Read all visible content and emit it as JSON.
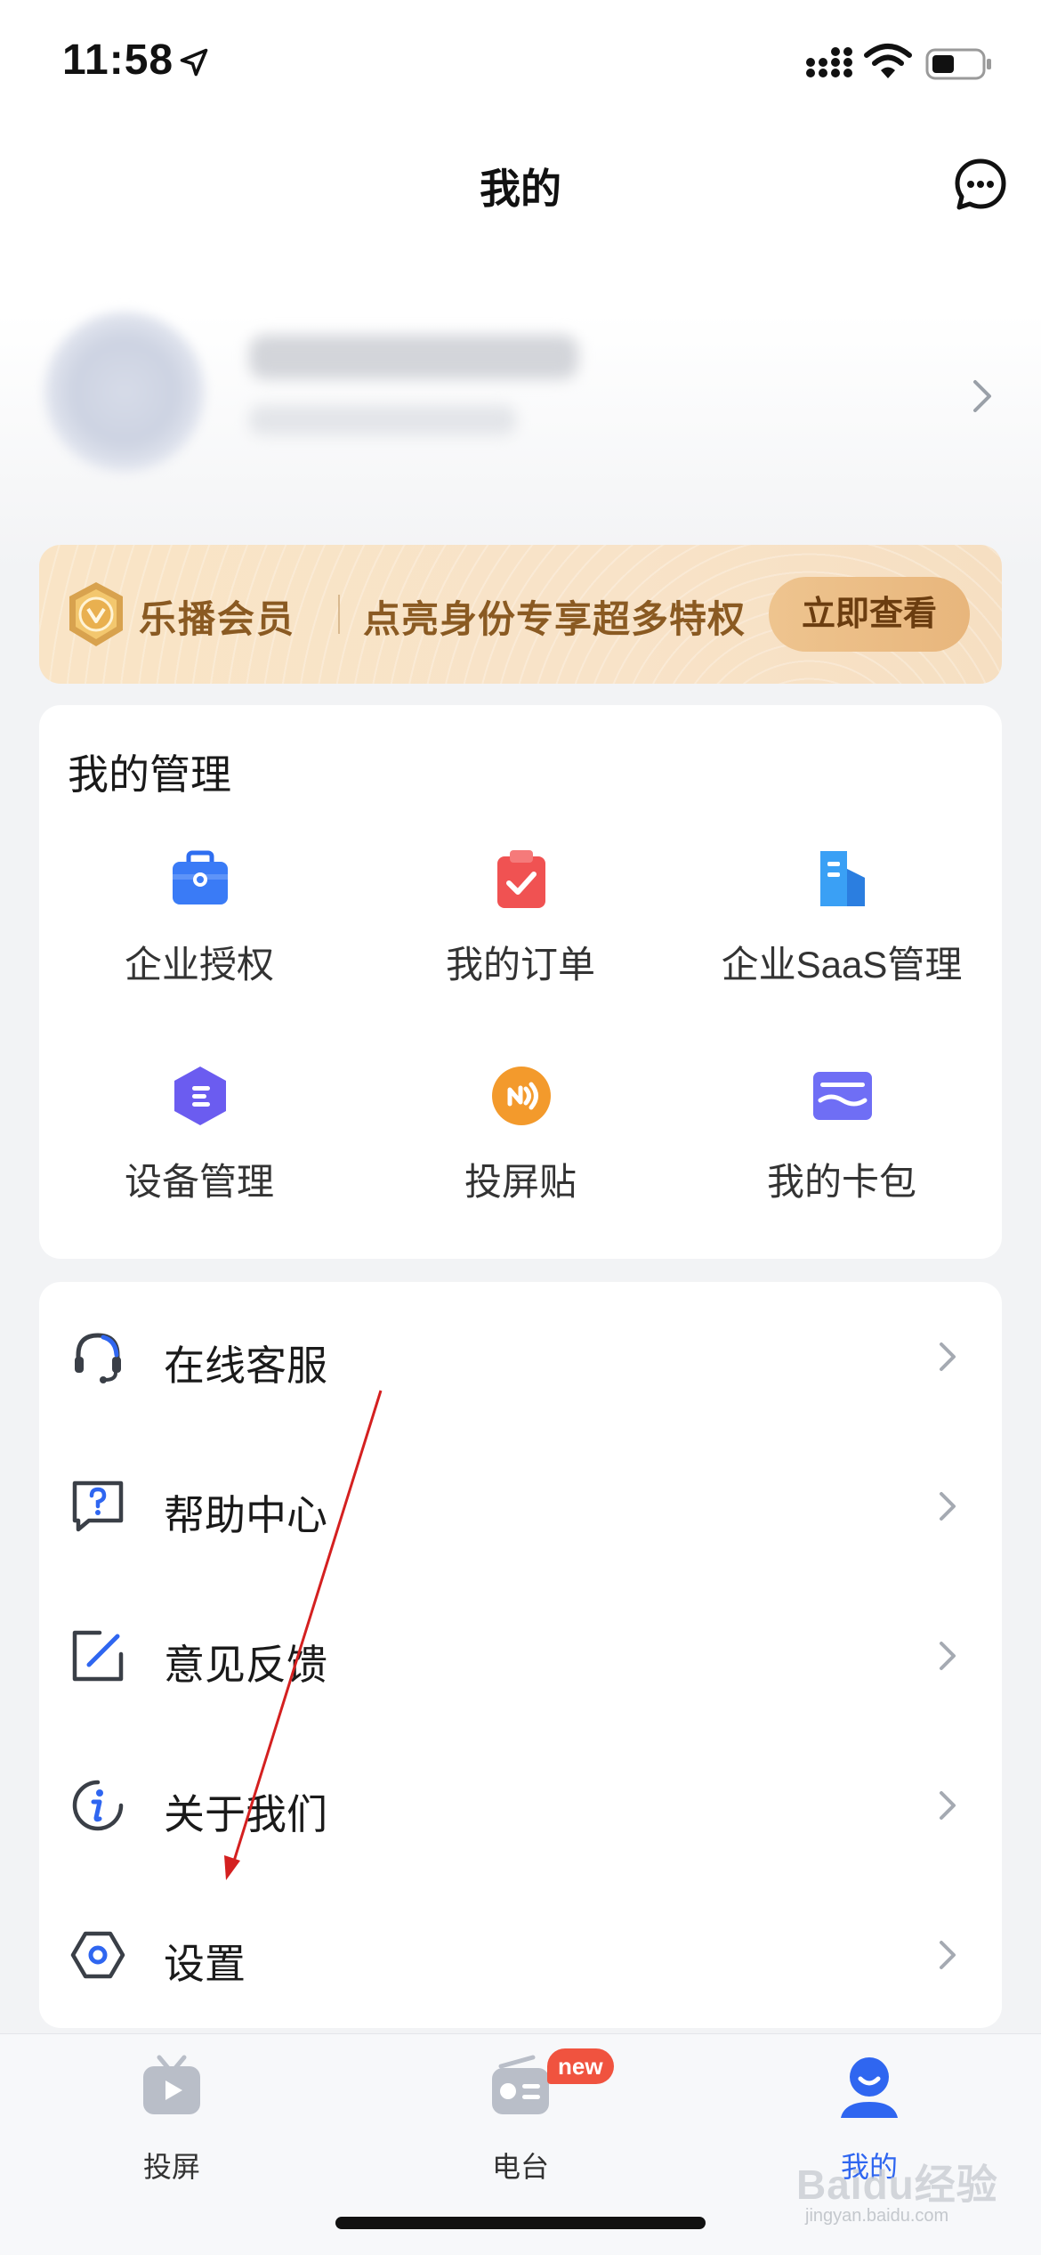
{
  "status_bar": {
    "time": "11:58"
  },
  "header": {
    "title": "我的"
  },
  "vip": {
    "title": "乐播会员",
    "description": "点亮身份专享超多特权",
    "button": "立即查看"
  },
  "management": {
    "title": "我的管理",
    "items": [
      {
        "label": "企业授权",
        "icon": "briefcase-icon",
        "color": "#3a7bf6"
      },
      {
        "label": "我的订单",
        "icon": "clipboard-check-icon",
        "color": "#f05252"
      },
      {
        "label": "企业SaaS管理",
        "icon": "building-icon",
        "color": "#3aa0f5"
      },
      {
        "label": "设备管理",
        "icon": "hexagon-list-icon",
        "color": "#6b5cf0"
      },
      {
        "label": "投屏贴",
        "icon": "nfc-sticker-icon",
        "color": "#f39a2c"
      },
      {
        "label": "我的卡包",
        "icon": "card-wallet-icon",
        "color": "#6f6ef5"
      }
    ]
  },
  "menu": [
    {
      "label": "在线客服",
      "icon": "headset-icon"
    },
    {
      "label": "帮助中心",
      "icon": "help-question-icon"
    },
    {
      "label": "意见反馈",
      "icon": "edit-feedback-icon"
    },
    {
      "label": "关于我们",
      "icon": "info-icon"
    },
    {
      "label": "设置",
      "icon": "settings-hexagon-icon"
    }
  ],
  "tabbar": [
    {
      "label": "投屏",
      "icon": "tv-play-icon",
      "active": false
    },
    {
      "label": "电台",
      "icon": "radio-icon",
      "active": false,
      "badge": "new"
    },
    {
      "label": "我的",
      "icon": "user-profile-icon",
      "active": true
    }
  ],
  "watermark": {
    "text": "Baidu经验",
    "sub": "jingyan.baidu.com"
  },
  "colors": {
    "accent": "#2f66f0",
    "vip_text": "#8a5a22",
    "badge": "#f0533f",
    "annotation": "#d42020"
  }
}
